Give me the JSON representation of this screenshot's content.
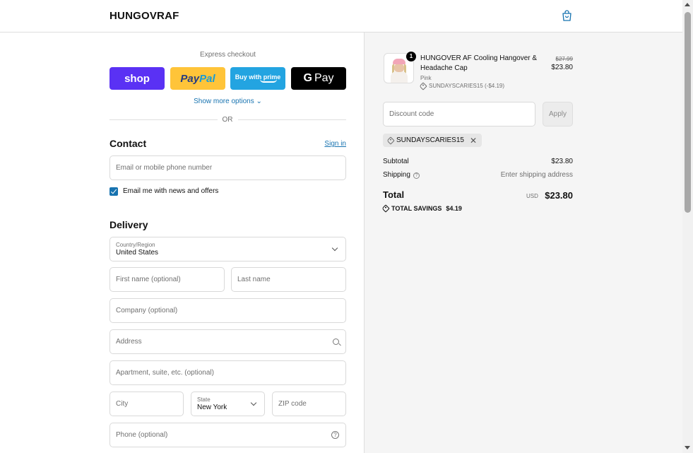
{
  "header": {
    "brand": "HUNGOVRAF",
    "cart_icon": "shopping-bag-icon"
  },
  "express": {
    "label": "Express checkout",
    "shop_label": "shop",
    "paypal_a": "Pay",
    "paypal_b": "Pal",
    "amazon_label": "Buy with prime",
    "gpay_g": "G",
    "gpay_label": "Pay",
    "more_options": "Show more options ⌄",
    "or": "OR"
  },
  "contact": {
    "title": "Contact",
    "sign_in": "Sign in",
    "email_placeholder": "Email or mobile phone number",
    "news_label": "Email me with news and offers",
    "news_checked": true
  },
  "delivery": {
    "title": "Delivery",
    "country_label": "Country/Region",
    "country_value": "United States",
    "first_name": "First name (optional)",
    "last_name": "Last name",
    "company": "Company (optional)",
    "address": "Address",
    "apartment": "Apartment, suite, etc. (optional)",
    "city": "City",
    "state_label": "State",
    "state_value": "New York",
    "zip": "ZIP code",
    "phone": "Phone (optional)"
  },
  "summary": {
    "item": {
      "quantity": "1",
      "name": "HUNGOVER AF Cooling Hangover & Headache Cap",
      "variant": "Pink",
      "discount": "SUNDAYSCARIES15 (-$4.19)",
      "original_price": "$27.99",
      "price": "$23.80"
    },
    "discount_placeholder": "Discount code",
    "apply": "Apply",
    "applied_code": "SUNDAYSCARIES15",
    "subtotal_label": "Subtotal",
    "subtotal_value": "$23.80",
    "shipping_label": "Shipping",
    "shipping_value": "Enter shipping address",
    "total_label": "Total",
    "total_currency": "USD",
    "total_value": "$23.80",
    "savings_label": "TOTAL SAVINGS",
    "savings_value": "$4.19"
  },
  "colors": {
    "accent": "#1773b0",
    "shop": "#5a31f4",
    "paypal": "#ffc439",
    "amazon": "#23a4e1",
    "gpay": "#000000",
    "summary_bg": "#f5f5f5"
  }
}
